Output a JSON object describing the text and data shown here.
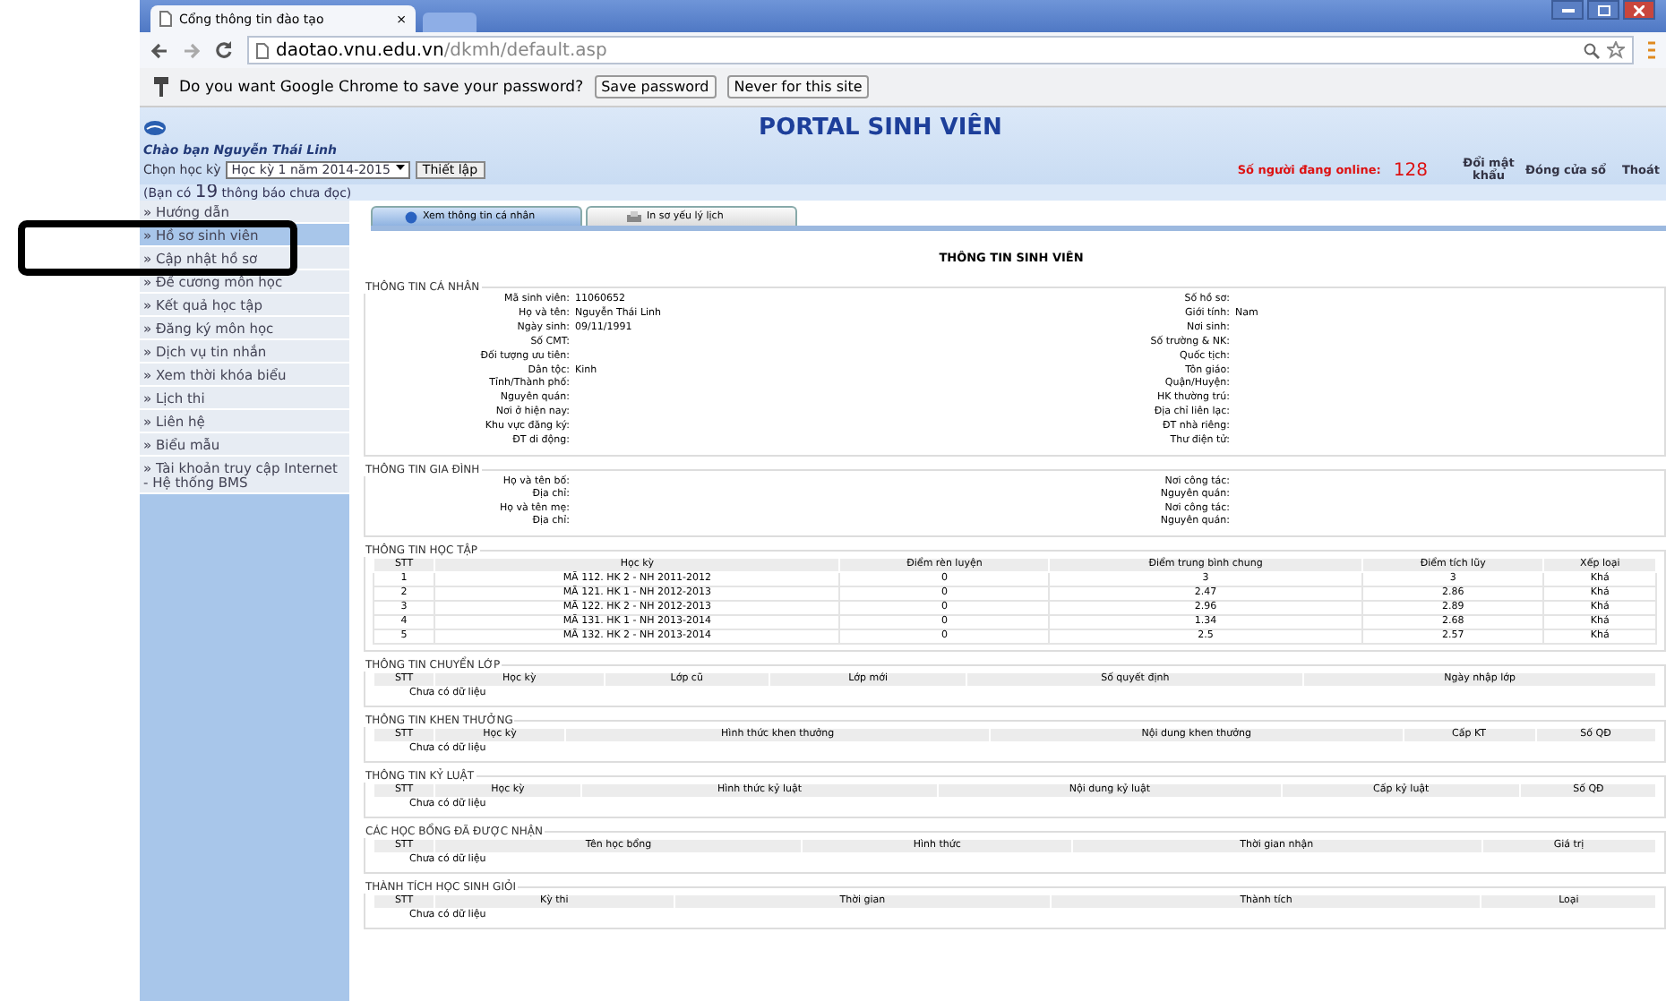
{
  "browser": {
    "tab_title": "Cổng thông tin đào tạo",
    "tab_close": "×",
    "url_host": "daotao.vnu.edu.vn",
    "url_path": "/dkmh/default.asp"
  },
  "password_bar": {
    "message": "Do you want Google Chrome to save your password?",
    "buttons": [
      "Save password",
      "Never for this site"
    ]
  },
  "portal": {
    "title": "PORTAL SINH VIÊN",
    "greeting": "Chào bạn Nguyễn Thái Linh",
    "semester_label": "Chọn học kỳ",
    "semester_value": "Học kỳ 1 năm 2014-2015",
    "set_button": "Thiết lập",
    "online_label": "Số người đang online:",
    "online_count": "128",
    "links": [
      "Đổi mật khẩu",
      "Đóng cửa sổ",
      "Thoát"
    ],
    "notice": "(Bạn có **19** thông báo chưa đọc)"
  },
  "sidebar": {
    "items": [
      {
        "label": "» Hướng dẫn",
        "selected": false
      },
      {
        "label": "» Hồ sơ sinh viên",
        "selected": true
      },
      {
        "label": "» Cập nhật hồ sơ",
        "selected": false
      },
      {
        "label": "» Đề cương môn học",
        "selected": false
      },
      {
        "label": "» Kết quả học tập",
        "selected": false
      },
      {
        "label": "» Đăng ký môn học",
        "selected": false
      },
      {
        "label": "» Dịch vụ tin nhắn",
        "selected": false
      },
      {
        "label": "» Xem thời khóa biểu",
        "selected": false
      },
      {
        "label": "» Lịch thi",
        "selected": false
      },
      {
        "label": "» Liên hệ",
        "selected": false
      },
      {
        "label": "» Biểu mẫu",
        "selected": false
      },
      {
        "label": "» Tài khoản truy cập Internet - Hệ thống BMS",
        "selected": false
      }
    ]
  },
  "tabs": [
    {
      "label": "Xem thông tin cá nhân",
      "selected": true
    },
    {
      "label": "In sơ yếu lý lịch",
      "selected": false
    }
  ],
  "page_title": "THÔNG TIN SINH VIÊN",
  "personal": {
    "title": "THÔNG TIN CÁ NHÂN",
    "left": [
      {
        "label": "Mã sinh viên:",
        "value": "11060652"
      },
      {
        "label": "Họ và tên:",
        "value": "Nguyễn Thái Linh"
      },
      {
        "label": "Ngày sinh:",
        "value": "09/11/1991"
      },
      {
        "label": "Số CMT:"
      },
      {
        "label": "Đối tượng ưu tiên:"
      },
      {
        "label": "Dân tộc:",
        "value": "Kinh"
      },
      {
        "label": "Tỉnh/Thành phố:"
      },
      {
        "label": "Nguyên quán:"
      },
      {
        "label": "Nơi ở hiện nay:"
      },
      {
        "label": "Khu vực đăng ký:"
      },
      {
        "label": "ĐT di động:"
      }
    ],
    "right": [
      {
        "label": "Số hồ sơ:"
      },
      {
        "label": "Giới tính:",
        "value": "Nam"
      },
      {
        "label": "Nơi sinh:"
      },
      {
        "label": "Số trường & NK:"
      },
      {
        "label": "Quốc tịch:"
      },
      {
        "label": "Tôn giáo:"
      },
      {
        "label": "Quận/Huyện:"
      },
      {
        "label": "HK thường trú:"
      },
      {
        "label": "Địa chỉ liên lạc:"
      },
      {
        "label": "ĐT nhà riêng:"
      },
      {
        "label": "Thư điện tử:"
      }
    ]
  },
  "family": {
    "title": "THÔNG TIN GIA ĐÌNH",
    "left": [
      {
        "label": "Họ và tên bố:"
      },
      {
        "label": "Địa chỉ:"
      },
      {
        "label": "Họ và tên mẹ:"
      },
      {
        "label": "Địa chỉ:"
      }
    ],
    "right": [
      {
        "label": "Nơi công tác:"
      },
      {
        "label": "Nguyên quán:"
      },
      {
        "label": "Nơi công tác:"
      },
      {
        "label": "Nguyên quán:"
      }
    ]
  },
  "tables": [
    {
      "title": "THÔNG TIN HỌC TẬP",
      "columns": [
        "STT",
        "Học kỳ",
        "Điểm rèn luyện",
        "Điểm trung bình chung",
        "Điểm tích lũy",
        "Xếp loại"
      ],
      "rows": [
        [
          "1",
          "MÃ 112. HK 2 - NH 2011-2012",
          "0",
          "3",
          "3",
          "Khá"
        ],
        [
          "2",
          "MÃ 121. HK 1 - NH 2012-2013",
          "0",
          "2.47",
          "2.86",
          "Khá"
        ],
        [
          "3",
          "MÃ 122. HK 2 - NH 2012-2013",
          "0",
          "2.96",
          "2.89",
          "Khá"
        ],
        [
          "4",
          "MÃ 131. HK 1 - NH 2013-2014",
          "0",
          "1.34",
          "2.68",
          "Khá"
        ],
        [
          "5",
          "MÃ 132. HK 2 - NH 2013-2014",
          "0",
          "2.5",
          "2.57",
          "Khá"
        ]
      ]
    },
    {
      "title": "THÔNG TIN CHUYỂN LỚP",
      "columns": [
        "STT",
        "Học kỳ",
        "Lớp cũ",
        "Lớp mới",
        "Số quyết định",
        "Ngày nhập lớp"
      ],
      "empty": "Chưa có dữ liệu"
    },
    {
      "title": "THÔNG TIN KHEN THƯỞNG",
      "columns": [
        "STT",
        "Học kỳ",
        "Hình thức khen thưởng",
        "Nội dung khen thưởng",
        "Cấp KT",
        "Số QĐ"
      ],
      "empty": "Chưa có dữ liệu"
    },
    {
      "title": "THÔNG TIN KỶ LUẬT",
      "columns": [
        "STT",
        "Học kỳ",
        "Hình thức kỷ luật",
        "Nội dung kỷ luật",
        "Cấp kỷ luật",
        "Số QĐ"
      ],
      "empty": "Chưa có dữ liệu"
    },
    {
      "title": "CÁC HỌC BỔNG ĐÃ ĐƯỢC NHẬN",
      "columns": [
        "STT",
        "Tên học bổng",
        "Hình thức",
        "Thời gian nhận",
        "Giá trị"
      ],
      "empty": "Chưa có dữ liệu"
    },
    {
      "title": "THÀNH TÍCH HỌC SINH GIỎI",
      "columns": [
        "STT",
        "Kỳ thi",
        "Thời gian",
        "Thành tích",
        "Loại"
      ],
      "empty": "Chưa có dữ liệu"
    }
  ]
}
